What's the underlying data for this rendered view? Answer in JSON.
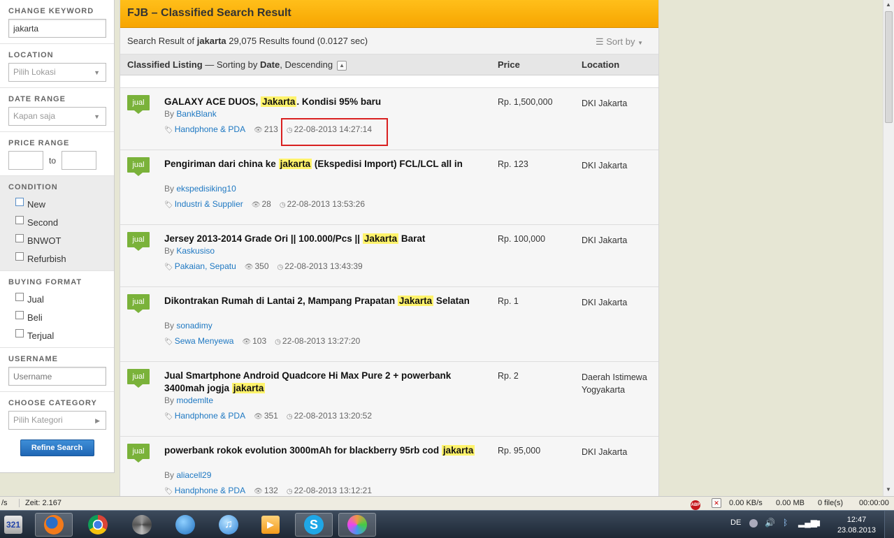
{
  "sidebar": {
    "keyword_title": "CHANGE KEYWORD",
    "keyword_value": "jakarta",
    "location_title": "LOCATION",
    "location_value": "Pilih Lokasi",
    "date_title": "DATE RANGE",
    "date_value": "Kapan saja",
    "price_title": "PRICE RANGE",
    "price_to": "to",
    "condition_title": "CONDITION",
    "conditions": [
      "New",
      "Second",
      "BNWOT",
      "Refurbish"
    ],
    "buying_title": "BUYING FORMAT",
    "buying": [
      "Jual",
      "Beli",
      "Terjual"
    ],
    "username_title": "USERNAME",
    "username_placeholder": "Username",
    "category_title": "CHOOSE CATEGORY",
    "category_value": "Pilih Kategori",
    "refine_label": "Refine Search"
  },
  "main": {
    "header": "FJB – Classified Search Result",
    "summary_prefix": "Search Result of",
    "summary_keyword": "jakarta",
    "summary_suffix": "29,075 Results found (0.0127 sec)",
    "sort_by": "Sort by",
    "list_title": "Classified Listing",
    "list_sorting_prefix": " — Sorting by ",
    "list_sort_field": "Date",
    "list_sort_sep": ", ",
    "list_sort_dir": "Descending",
    "col_price": "Price",
    "col_location": "Location"
  },
  "listings": [
    {
      "badge": "jual",
      "title_pre": "GALAXY ACE DUOS, ",
      "title_hl": "Jakarta",
      "title_post": ". Kondisi 95% baru",
      "by": "By",
      "user": "BankBlank",
      "category": "Handphone & PDA",
      "views": "213",
      "date": "22-08-2013 14:27:14",
      "price": "Rp. 1,500,000",
      "location": "DKI Jakarta"
    },
    {
      "badge": "jual",
      "title_pre": "Pengiriman dari china ke ",
      "title_hl": "jakarta",
      "title_post": " (Ekspedisi Import) FCL/LCL all in",
      "by": "By",
      "user": "ekspedisiking10",
      "category": "Industri & Supplier",
      "views": "28",
      "date": "22-08-2013 13:53:26",
      "price": "Rp. 123",
      "location": "DKI Jakarta"
    },
    {
      "badge": "jual",
      "title_pre": "Jersey 2013-2014 Grade Ori || 100.000/Pcs || ",
      "title_hl": "Jakarta",
      "title_post": " Barat",
      "by": "By",
      "user": "Kaskusiso",
      "category": "Pakaian, Sepatu",
      "views": "350",
      "date": "22-08-2013 13:43:39",
      "price": "Rp. 100,000",
      "location": "DKI Jakarta"
    },
    {
      "badge": "jual",
      "title_pre": "Dikontrakan Rumah di Lantai 2, Mampang Prapatan ",
      "title_hl": "Jakarta",
      "title_post": " Selatan",
      "by": "By",
      "user": "sonadimy",
      "category": "Sewa Menyewa",
      "views": "103",
      "date": "22-08-2013 13:27:20",
      "price": "Rp. 1",
      "location": "DKI Jakarta"
    },
    {
      "badge": "jual",
      "title_pre": "Jual Smartphone Android Quadcore Hi Max Pure 2 + powerbank 3400mah jogja ",
      "title_hl": "jakarta",
      "title_post": "",
      "by": "By",
      "user": "modemlte",
      "category": "Handphone & PDA",
      "views": "351",
      "date": "22-08-2013 13:20:52",
      "price": "Rp. 2",
      "location": "Daerah Istimewa Yogyakarta"
    },
    {
      "badge": "jual",
      "title_pre": "powerbank rokok evolution 3000mAh for blackberry 95rb cod ",
      "title_hl": "jakarta",
      "title_post": "",
      "by": "By",
      "user": "aliacell29",
      "category": "Handphone & PDA",
      "views": "132",
      "date": "22-08-2013 13:12:21",
      "price": "Rp. 95,000",
      "location": "DKI Jakarta"
    }
  ],
  "statusbar": {
    "left": "/s",
    "zeit": "Zeit: 2.167",
    "abp": "ABP",
    "speed": "0.00 KB/s",
    "mb": "0.00 MB",
    "files": "0 file(s)",
    "time": "00:00:00"
  },
  "taskbar": {
    "lang": "DE",
    "clock_time": "12:47",
    "clock_date": "23.08.2013",
    "apps": [
      "media-player-321-icon",
      "firefox-icon",
      "chrome-icon",
      "aperture-icon",
      "dolphin-icon",
      "itunes-icon",
      "video-player-icon",
      "skype-icon",
      "paint-icon"
    ]
  }
}
